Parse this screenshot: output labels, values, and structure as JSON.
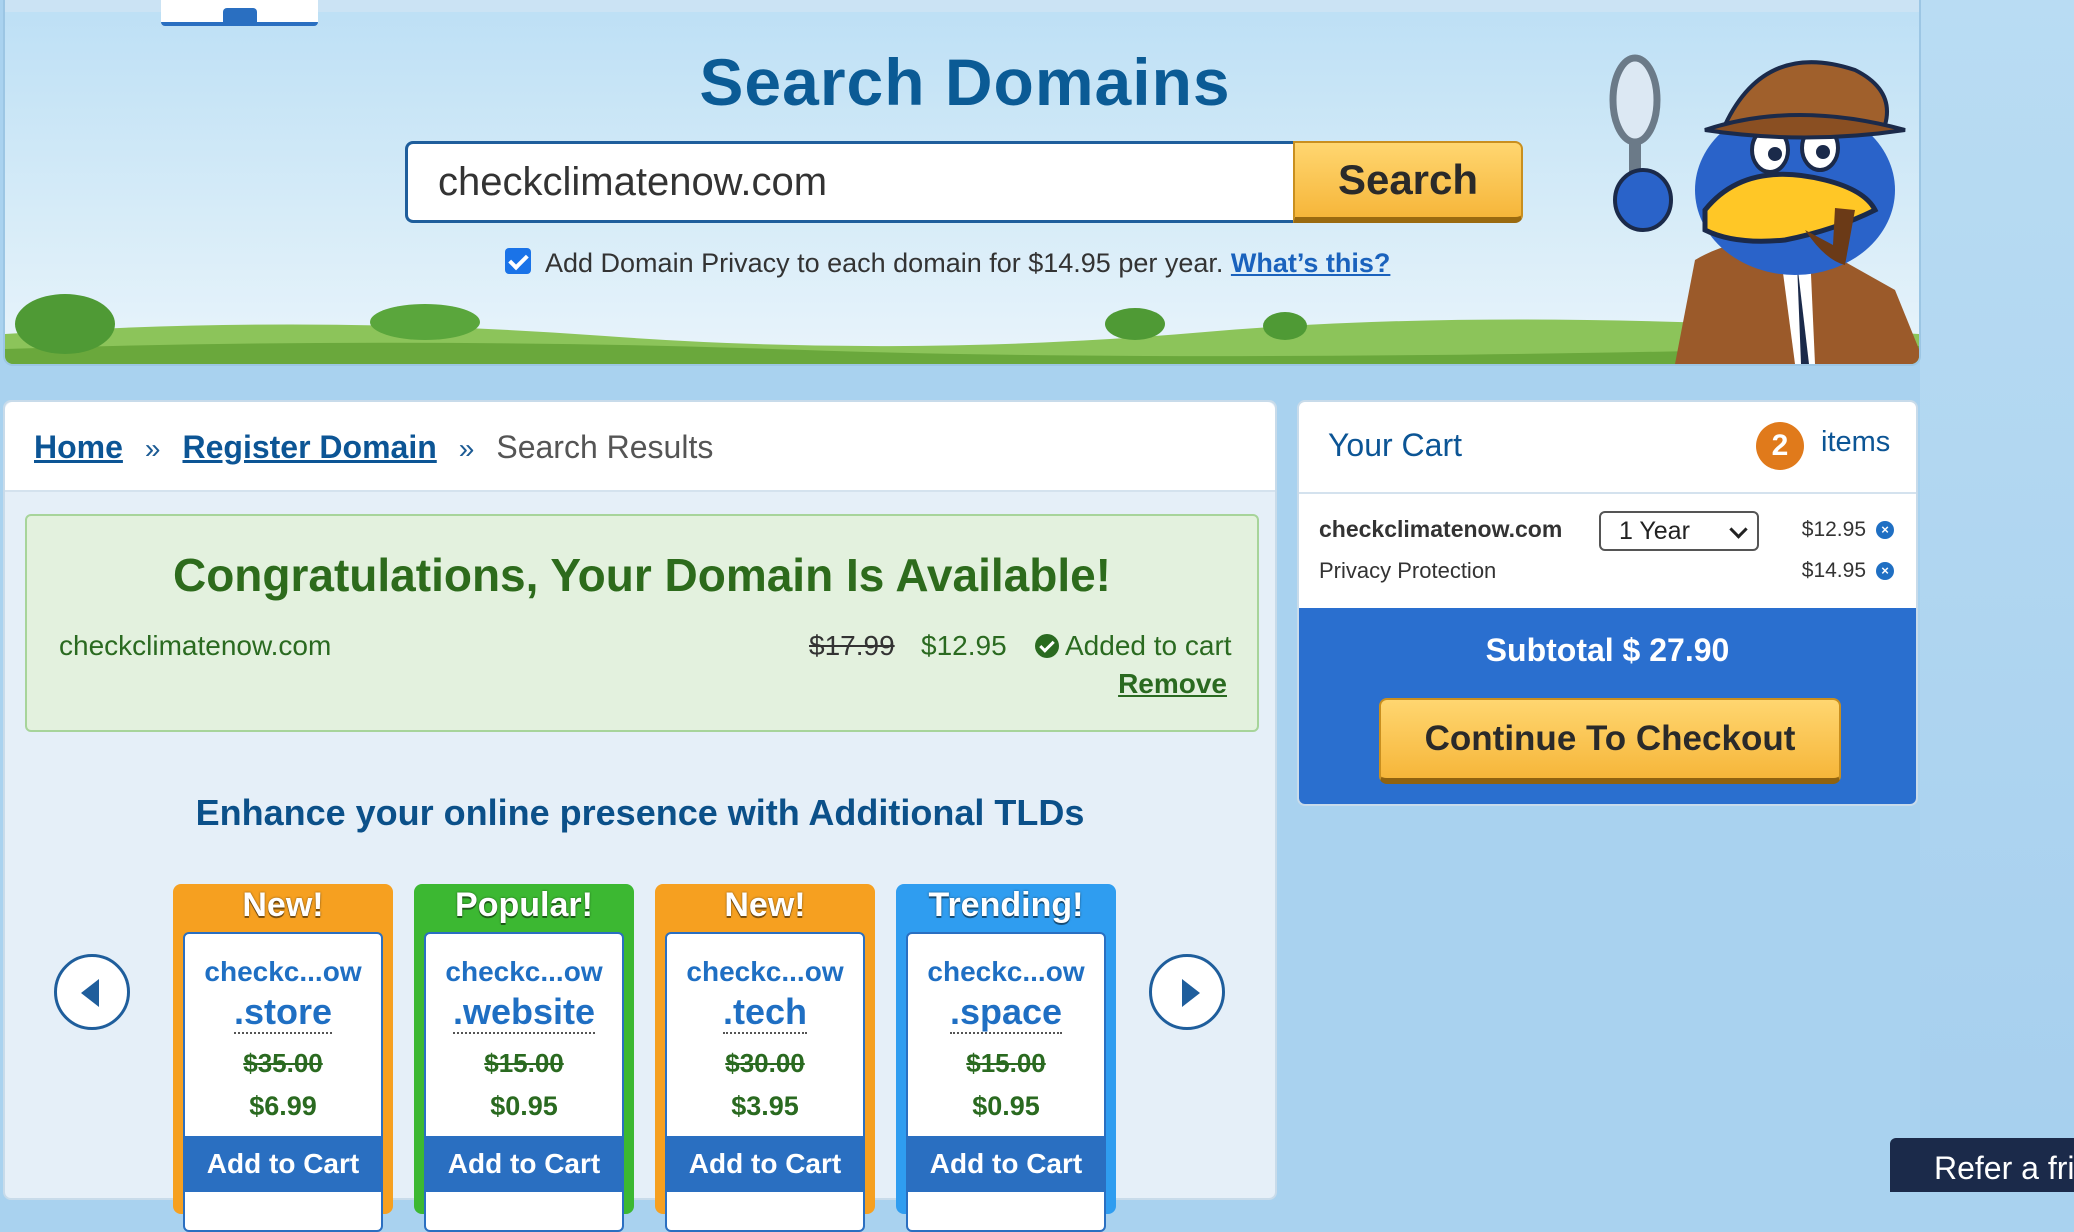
{
  "hero": {
    "title": "Search Domains",
    "search_value": "checkclimatenow.com",
    "search_button": "Search",
    "privacy_text": "Add Domain Privacy to each domain for $14.95 per year.",
    "privacy_link": "What’s this?"
  },
  "breadcrumb": {
    "home": "Home",
    "register": "Register Domain",
    "current": "Search Results",
    "separator": "»"
  },
  "availability": {
    "title": "Congratulations, Your Domain Is Available!",
    "domain": "checkclimatenow.com",
    "old_price": "$17.99",
    "new_price": "$12.95",
    "added_label": "Added to cart",
    "remove_label": "Remove"
  },
  "enhance_title": "Enhance your online presence with Additional TLDs",
  "tlds": [
    {
      "tag": "New!",
      "name": "checkc...ow",
      "ext": ".store",
      "old": "$35.00",
      "new": "$6.99",
      "add": "Add to Cart",
      "color": "#f6a020"
    },
    {
      "tag": "Popular!",
      "name": "checkc...ow",
      "ext": ".website",
      "old": "$15.00",
      "new": "$0.95",
      "add": "Add to Cart",
      "color": "#3cb832"
    },
    {
      "tag": "New!",
      "name": "checkc...ow",
      "ext": ".tech",
      "old": "$30.00",
      "new": "$3.95",
      "add": "Add to Cart",
      "color": "#f6a020"
    },
    {
      "tag": "Trending!",
      "name": "checkc...ow",
      "ext": ".space",
      "old": "$15.00",
      "new": "$0.95",
      "add": "Add to Cart",
      "color": "#2f9df0"
    }
  ],
  "cart": {
    "title": "Your Cart",
    "count": "2",
    "items_label": "items",
    "line1_name": "checkclimatenow.com",
    "line1_term": "1 Year",
    "line1_price": "$12.95",
    "line2_name": "Privacy Protection",
    "line2_price": "$14.95",
    "subtotal": "Subtotal $ 27.90",
    "checkout": "Continue To Checkout"
  },
  "refer": "Refer a friend"
}
